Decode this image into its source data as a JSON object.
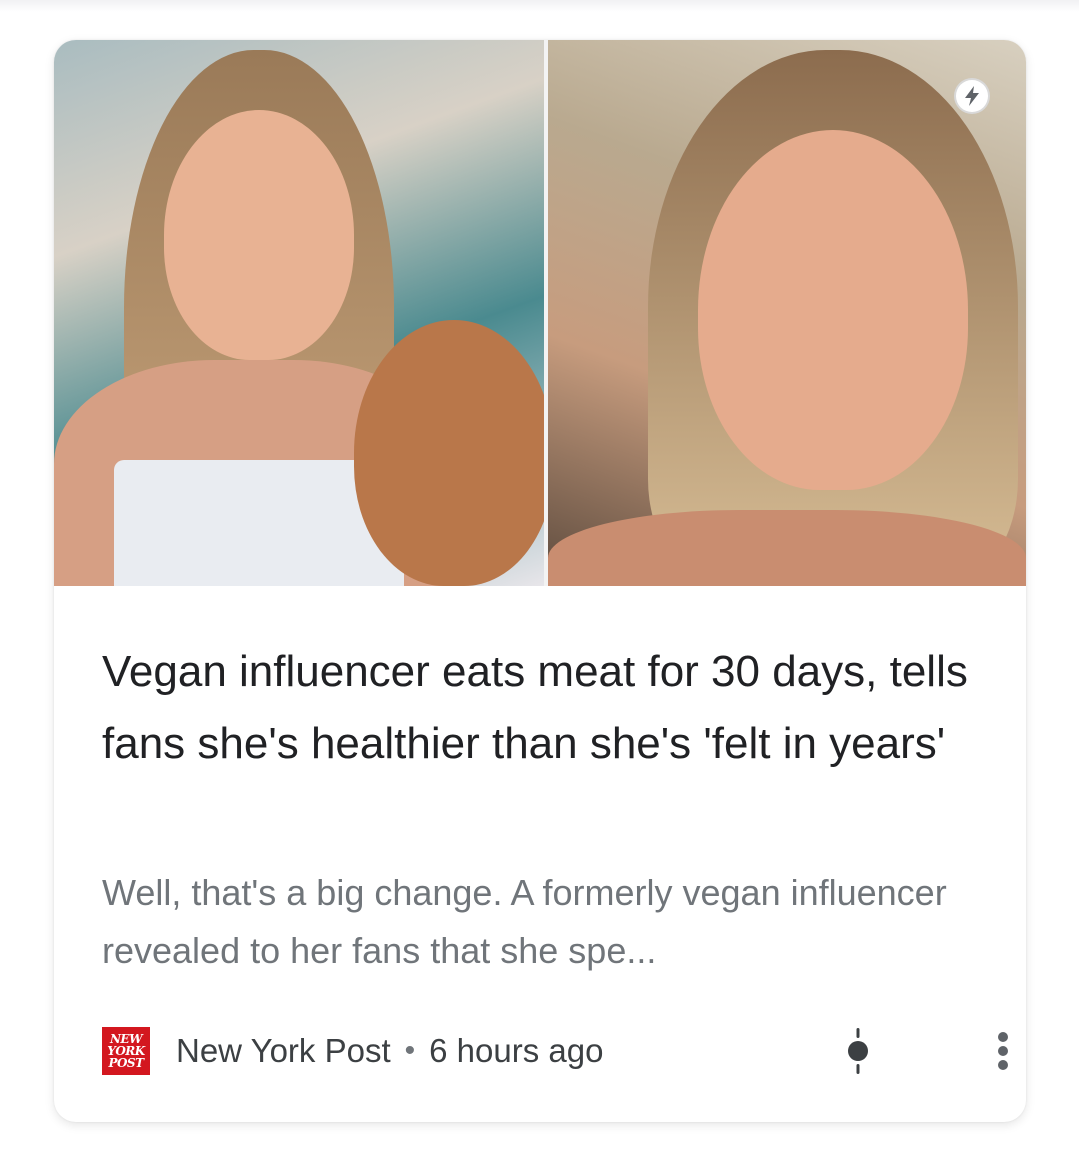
{
  "article": {
    "headline": "Vegan influencer eats meat for 30 days, tells fans she's healthier than she's 'felt in years'",
    "snippet": "Well, that's a big change. A formerly vegan influencer revealed to her fans that she spe...",
    "source": "New York Post",
    "separator": "•",
    "time": "6 hours ago",
    "logo_lines": [
      "NEW",
      "YORK",
      "POST"
    ]
  },
  "colors": {
    "headline": "#202124",
    "snippet": "#70757a",
    "logo_red": "#d3171f"
  },
  "icons": {
    "amp": "lightning-bolt-icon",
    "weather": "tracking-dot-icon",
    "more": "more-vertical-icon"
  }
}
